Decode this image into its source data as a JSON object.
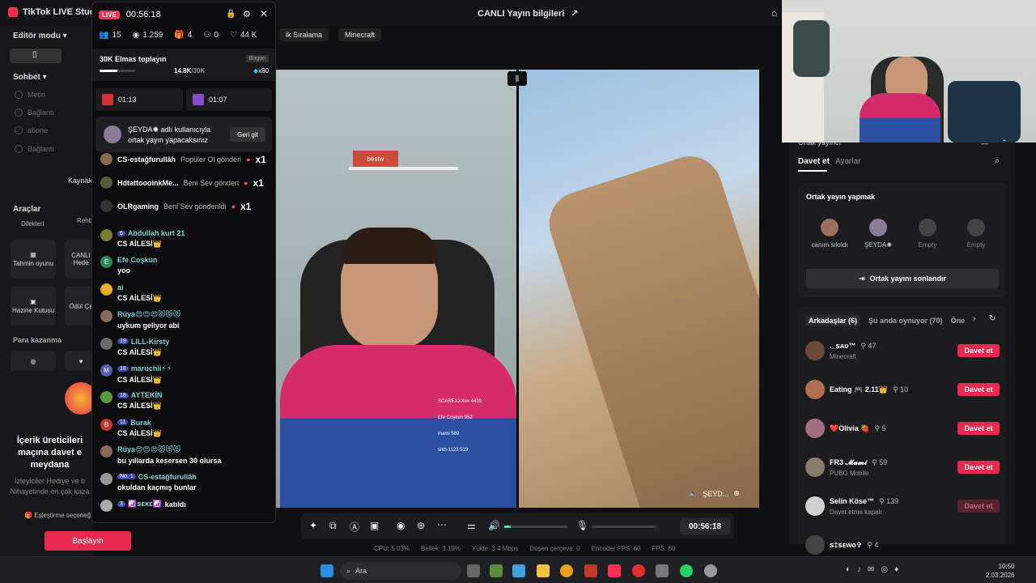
{
  "app": {
    "title": "TikTok LIVE Studio"
  },
  "header": {
    "center_title": "CANLI Yayın bilgileri",
    "top_chips": [
      "ik Sıralama",
      "Minecraft"
    ]
  },
  "leftbar": {
    "mode": "Editör modu",
    "sohbet": "Sohbet",
    "items": [
      "Metin",
      "Bağlantı",
      "abone",
      "Bağlantı"
    ],
    "kaynak": "Kaynak",
    "araclar": "Araçlar",
    "tools": [
      "Dilekleri",
      "Rehb",
      "Tahmin oyunu",
      "CANLI Hede",
      "Hazine Kutusu",
      "Ödül Ça"
    ],
    "para": "Para kazanma",
    "promo_title": "İçerik üreticileri maçına davet e meydana",
    "promo_body": "İzleyiciler Hediye ve b Nihayetinde en çok kaza",
    "promo_link": "Eşleştirme seçeneğ",
    "start_button": "Başlayın"
  },
  "chat": {
    "live": "LIVE",
    "timer": "00:56:18",
    "stats": {
      "viewers": "15",
      "views": "1.259",
      "gifts": "4",
      "follows": "0",
      "likes": "44 K"
    },
    "goal_title": "30K Elmas toplayın",
    "goal_today": "Bugün",
    "goal_progress": "14.8K",
    "goal_total": "/30K",
    "goal_multiplier": "x80",
    "goal_fraction": 0.49,
    "timers": [
      "01:13",
      "01:07"
    ],
    "cohost_notice": "ŞEYDA✺ adlı kullanıcıyla ortak yayın yapacaksınız",
    "cohost_back": "Geri git",
    "gifts": [
      {
        "user": "CS-estağfurullâh",
        "text": "Popüler Ol gönderi",
        "count": "x1"
      },
      {
        "user": "HdtattoooinkMe...",
        "text": "Beni Sev gönderi",
        "count": "x1"
      },
      {
        "user": "OLRgaming",
        "text": "Beni Sev gönderildi",
        "count": "x1"
      }
    ],
    "messages": [
      {
        "initial": "",
        "level": "6",
        "user": "Abdullah kurt 21",
        "text": "CS AİLESİ👑"
      },
      {
        "initial": "E",
        "level": "",
        "user": "Efe Coşkun",
        "text": "yoo"
      },
      {
        "initial": "",
        "level": "",
        "user": "ai",
        "text": "CS AİLESİ👑"
      },
      {
        "initial": "",
        "level": "",
        "user": "Rüya😍😍😍😻😻😻",
        "text": "uykum geliyor abi"
      },
      {
        "initial": "",
        "level": "19",
        "user": "LILL-Kirsty",
        "text": "CS AİLESİ👑"
      },
      {
        "initial": "M",
        "level": "18",
        "user": "maruchii⚡⚡",
        "text": "CS AİLESİ👑"
      },
      {
        "initial": "",
        "level": "18",
        "user": "AYTEKİN",
        "text": "CS AİLESİ👑"
      },
      {
        "initial": "B",
        "level": "11",
        "user": "Burak",
        "text": "CS AİLESİ👑"
      },
      {
        "initial": "",
        "level": "",
        "user": "Rüya😍😍😍😻😻😻",
        "text": "bu yıllarda kesersen 30 olursa"
      },
      {
        "initial": "",
        "level": "No. 1",
        "user": "CS-estağfurullâh",
        "text": "okuldan kaçmış bunlar"
      },
      {
        "initial": "",
        "level": "3",
        "user": "☯️ꜱᴇᴋᴇ☯️",
        "text": "katıldı"
      }
    ]
  },
  "video": {
    "cohost_label": "ŞEYD...",
    "shelf_sign": "bestw",
    "overlay_list": [
      "SCAREXXXex 4439",
      "Efe Coşkun 952",
      "mami 589",
      "sikh-1123 519"
    ]
  },
  "toolbar": {
    "timer": "00:56:18"
  },
  "statusline": [
    "CPU: 5.03%",
    "Bellek: 3.19%",
    "Yükle: 3.4 Mbps",
    "Düşen çerçeve: 0",
    "Encoder FPS: 60",
    "FPS: 60"
  ],
  "right": {
    "header_title": "Ortak yayıncı",
    "tabs": [
      "Davet et",
      "Ayarlar"
    ],
    "cohost_title": "Ortak yayın yapmak",
    "slots": [
      "canım sıkıldı",
      "ŞEYDA✺",
      "Empty",
      "Empty"
    ],
    "end_button": "Ortak yayını sonlandır",
    "filters": [
      "Arkadaşlar (6)",
      "Şu anda oynuyor (70)",
      "Öne"
    ],
    "friends": [
      {
        "name": "._ꜱᴀᴜ™",
        "count": "47",
        "sub": "Minecraft",
        "button": "Davet et",
        "enabled": true
      },
      {
        "name": "Eating 🎮 2.11👑",
        "count": "10",
        "sub": "",
        "button": "Davet et",
        "enabled": true
      },
      {
        "name": "❤️Olivia 🍓",
        "count": "5",
        "sub": "",
        "button": "Davet et",
        "enabled": true
      },
      {
        "name": "FR3 𝓜𝓪𝓶𝓲",
        "count": "59",
        "sub": "PUBG Mobile",
        "button": "Davet et",
        "enabled": true
      },
      {
        "name": "Selin Köse™",
        "count": "139",
        "sub": "Davet etme kapalı",
        "button": "Davet et",
        "enabled": false
      },
      {
        "name": "ꜱ‡ꜱᴇᴡᴏ✞",
        "count": "4",
        "sub": "",
        "button": "",
        "enabled": true
      }
    ]
  },
  "taskbar": {
    "search": "Ara",
    "time": "10:50",
    "date": "2.03.2026"
  },
  "colors": {
    "accent": "#e8294f",
    "live": "#ff2d55",
    "panel": "#17171a"
  }
}
